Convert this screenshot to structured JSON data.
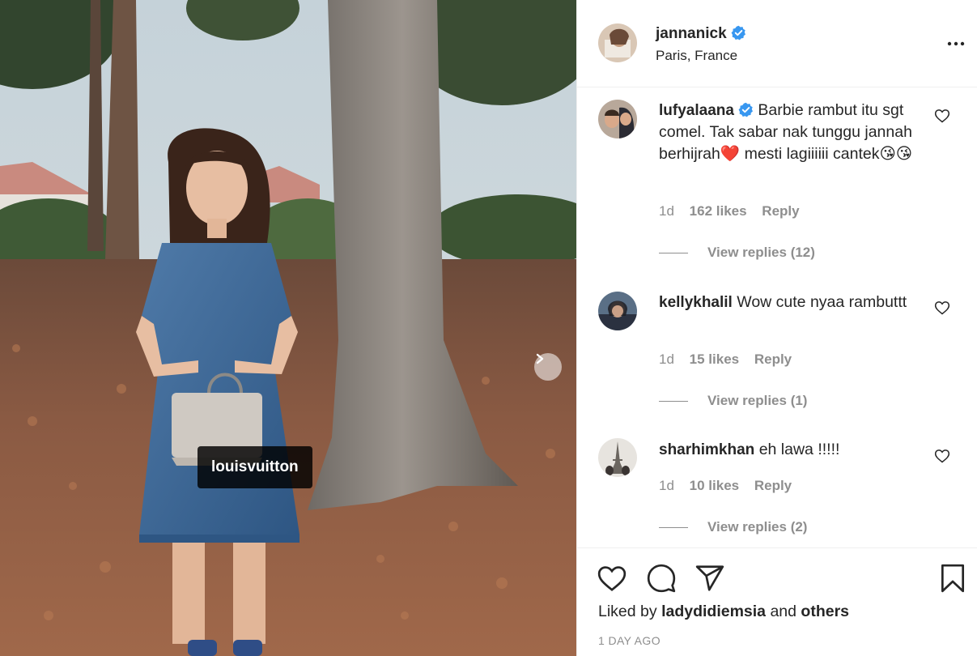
{
  "post": {
    "username": "jannanick",
    "location": "Paris, France",
    "tag_label": "louisvuitton"
  },
  "comments": [
    {
      "username": "lufyalaana",
      "verified": true,
      "text": "Barbie rambut itu sgt comel. Tak sabar nak tunggu jannah berhijrah❤️ mesti lagiiiiii cantek😘😘",
      "time": "1d",
      "likes": "162 likes",
      "reply": "Reply",
      "view_replies": "View replies (12)"
    },
    {
      "username": "kellykhalil",
      "verified": false,
      "text": "Wow cute nyaa rambuttt",
      "time": "1d",
      "likes": "15 likes",
      "reply": "Reply",
      "view_replies": "View replies (1)"
    },
    {
      "username": "sharhimkhan",
      "verified": false,
      "text": "eh lawa !!!!!",
      "time": "1d",
      "likes": "10 likes",
      "reply": "Reply",
      "view_replies": "View replies (2)"
    }
  ],
  "footer": {
    "liked_by_prefix": "Liked by",
    "liked_by_user": "ladydidiemsia",
    "liked_by_and": "and",
    "liked_by_others": "others",
    "timestamp": "1 DAY AGO"
  },
  "icons": {
    "verified": "verified-badge-icon",
    "more": "more-options-icon",
    "like": "heart-icon",
    "comment": "comment-icon",
    "share": "share-icon",
    "save": "bookmark-icon",
    "next": "chevron-right-icon"
  },
  "colors": {
    "verified_blue": "#3897f0",
    "secondary_text": "#8e8e8e",
    "border": "#efefef"
  }
}
